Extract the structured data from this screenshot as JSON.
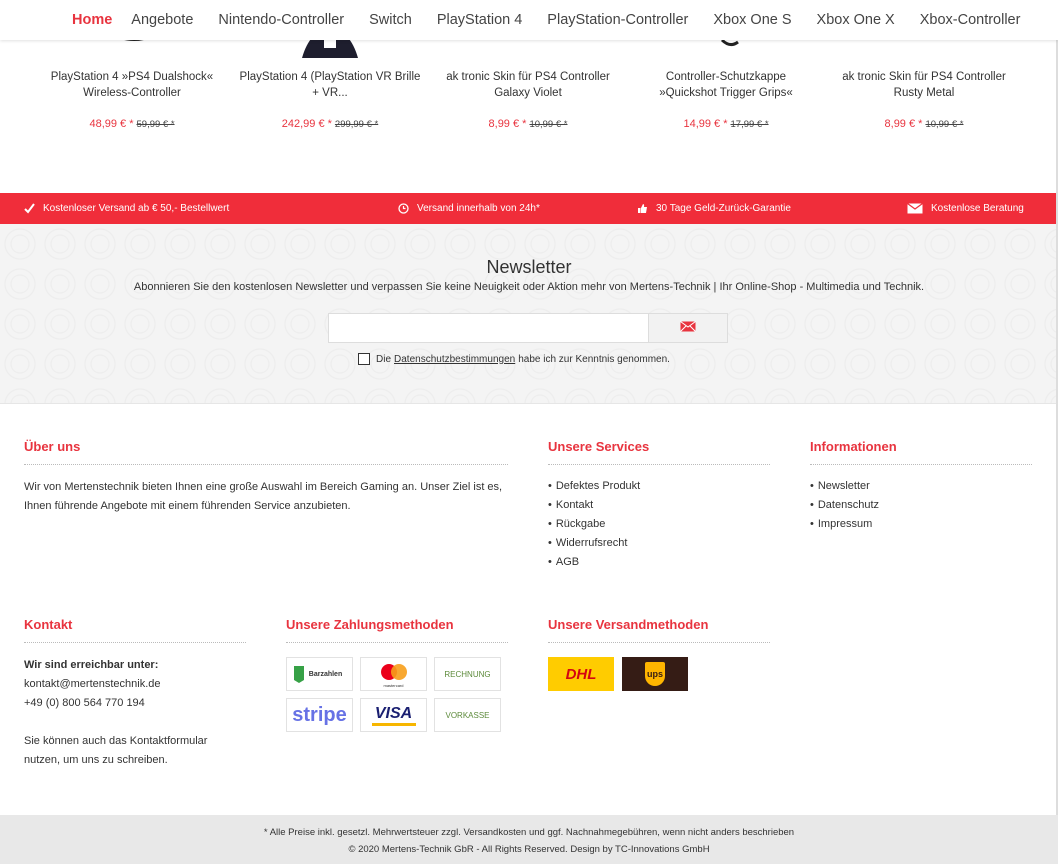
{
  "nav": {
    "items": [
      "Home",
      "Angebote",
      "Nintendo-Controller",
      "Switch",
      "PlayStation 4",
      "PlayStation-Controller",
      "Xbox One S",
      "Xbox One X",
      "Xbox-Controller"
    ]
  },
  "products": [
    {
      "title_line1": "PlayStation 4 »PS4 Dualshock«",
      "title_line2": "Wireless-Controller",
      "price": "48,99 € *",
      "old_price": "59,99 € *"
    },
    {
      "title_line1": "PlayStation 4 (PlayStation VR Brille",
      "title_line2": "+ VR...",
      "price": "242,99 € *",
      "old_price": "299,99 € *"
    },
    {
      "title_line1": "ak tronic Skin für PS4 Controller",
      "title_line2": "Galaxy Violet",
      "price": "8,99 € *",
      "old_price": "10,99 € *"
    },
    {
      "title_line1": "Controller-Schutzkappe",
      "title_line2": "»Quickshot Trigger Grips«",
      "price": "14,99 € *",
      "old_price": "17,99 € *"
    },
    {
      "title_line1": "ak tronic Skin für PS4 Controller",
      "title_line2": "Rusty Metal",
      "price": "8,99 € *",
      "old_price": "10,99 € *"
    }
  ],
  "usp": {
    "shipping": "Kostenloser Versand ab € 50,- Bestellwert",
    "delivery": "Versand innerhalb von 24h*",
    "guarantee": "30 Tage Geld-Zurück-Garantie",
    "consulting": "Kostenlose Beratung"
  },
  "newsletter": {
    "title": "Newsletter",
    "subtitle": "Abonnieren Sie den kostenlosen Newsletter und verpassen Sie keine Neuigkeit oder Aktion mehr von Mertens-Technik | Ihr Online-Shop - Multimedia und Technik.",
    "email_value": "",
    "privacy_prefix": "Die",
    "privacy_link": "Datenschutzbestimmungen",
    "privacy_suffix": "habe ich zur Kenntnis genommen."
  },
  "footer": {
    "about": {
      "heading": "Über uns",
      "text": "Wir von Mertenstechnik bieten Ihnen eine große Auswahl im Bereich Gaming an. Unser Ziel ist es, Ihnen führende Angebote mit einem führenden Service anzubieten."
    },
    "services": {
      "heading": "Unsere Services",
      "items": [
        "Defektes Produkt",
        "Kontakt",
        "Rückgabe",
        "Widerrufsrecht",
        "AGB"
      ]
    },
    "info": {
      "heading": "Informationen",
      "items": [
        "Newsletter",
        "Datenschutz",
        "Impressum"
      ]
    },
    "contact": {
      "heading": "Kontakt",
      "reach_label": "Wir sind erreichbar unter:",
      "email": "kontakt@mertenstechnik.de",
      "phone": "+49 (0) 800 564 770 194",
      "form_text": "Sie können auch das Kontaktformular nutzen, um uns zu schreiben."
    },
    "payment": {
      "heading": "Unsere Zahlungsmethoden",
      "methods": [
        "Barzahlen",
        "mastercard",
        "RECHNUNG",
        "stripe",
        "VISA",
        "VORKASSE"
      ]
    },
    "shipping": {
      "heading": "Unsere Versandmethoden",
      "carriers": [
        "DHL",
        "ups"
      ]
    }
  },
  "bottom": {
    "vat_note": "* Alle Preise inkl. gesetzl. Mehrwertsteuer zzgl. Versandkosten und ggf. Nachnahmegebühren, wenn nicht anders beschrieben",
    "copyright": "© 2020 Mertens-Technik GbR - All Rights Reserved. Design by TC-Innovations GmbH"
  },
  "colors": {
    "accent": "#e8343f",
    "usp_bar": "#f02d3a",
    "dhl_yellow": "#ffcc00",
    "ups_brown": "#351c15"
  }
}
